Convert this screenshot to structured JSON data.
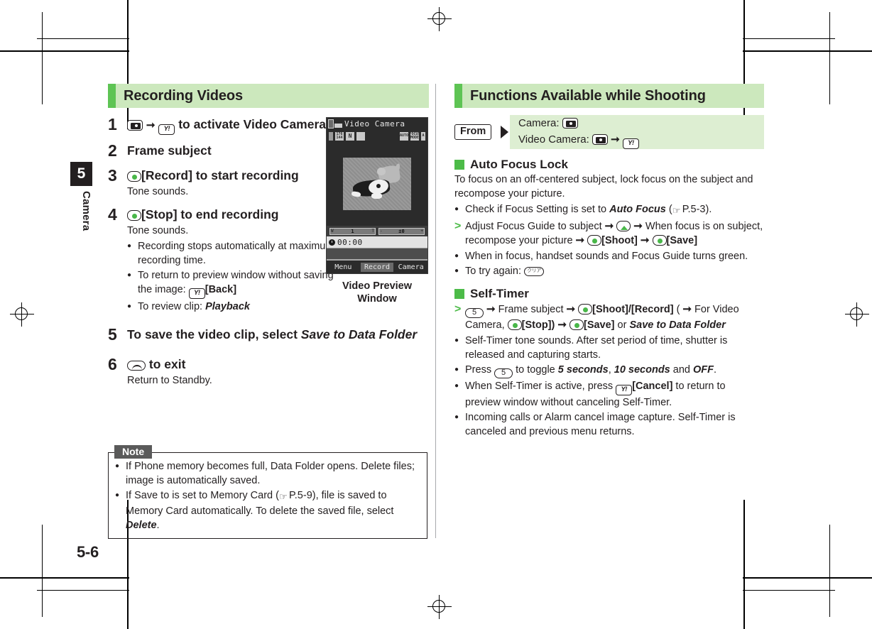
{
  "page": {
    "folio": "5-6",
    "chapter_number": "5",
    "chapter_name": "Camera"
  },
  "left_column": {
    "section_title": "Recording Videos",
    "steps": [
      {
        "number": "1",
        "text_before": "",
        "text_after": " to activate Video Camera",
        "note": ""
      },
      {
        "number": "2",
        "text": "Frame subject"
      },
      {
        "number": "3",
        "label": "[Record] to start recording",
        "note": "Tone sounds."
      },
      {
        "number": "4",
        "label": "[Stop] to end recording",
        "note": "Tone sounds."
      },
      {
        "number": "5",
        "text_plain": "To save the video clip, select ",
        "text_italic": "Save to Data Folder"
      },
      {
        "number": "6",
        "label": " to exit",
        "note": "Return to Standby."
      }
    ],
    "step4_bullets": [
      "Recording stops automatically at maximum recording time.",
      "To return to preview window without saving the image:",
      "To review clip:"
    ],
    "step4_bullet2_key": "[Back]",
    "step4_bullet3_italic": "Playback",
    "note_box": {
      "label": "Note",
      "items": [
        {
          "p1": "If Phone memory becomes full, Data Folder opens. Delete files; image is automatically saved."
        },
        {
          "p1": "If Save to is set to Memory Card (",
          "ref": "P.5-9",
          "p2": "), file is saved to Memory Card automatically. To delete the saved file, select ",
          "em": "Delete",
          "p3": "."
        }
      ]
    },
    "figure": {
      "caption_line1": "Video Preview",
      "caption_line2": "Window",
      "screen": {
        "title": "Video Camera",
        "icons": [
          "176 144",
          "N QVGA",
          "burst",
          "AUTO",
          "FOCUS MODE"
        ],
        "zoom_left": "W",
        "zoom_value": "1",
        "zoom_right": "T",
        "ev_left": "-",
        "ev_value": "±0",
        "ev_right": "+",
        "timer": "00:00",
        "softkeys": [
          "Menu",
          "Record",
          "Camera"
        ]
      }
    }
  },
  "right_column": {
    "section_title": "Functions Available while Shooting",
    "from_banner": {
      "tag": "From",
      "line1_label": "Camera:",
      "line2_label": "Video Camera:"
    },
    "topics": [
      {
        "heading": "Auto Focus Lock",
        "intro": "To focus on an off-centered subject, lock focus on the subject and recompose your picture.",
        "bullets": [
          {
            "p1": "Check if Focus Setting is set to ",
            "em": "Auto Focus",
            "p2": " (",
            "ref": "P.5-3",
            "p3": ")."
          },
          {
            "p1": "When in focus, handset sounds and Focus Guide turns green."
          },
          {
            "p1": "To try again:"
          }
        ],
        "procedure": {
          "p1": "Adjust Focus Guide to subject ",
          "p2": " When focus is on subject, recompose your picture ",
          "shoot": "[Shoot]",
          "save": "[Save]"
        }
      },
      {
        "heading": "Self-Timer",
        "procedure": {
          "p1": "Frame subject ",
          "shoot_record": "[Shoot]/[Record]",
          "p2": "( ",
          "p3": "For Video Camera,",
          "stop": "[Stop])",
          "save": "[Save]",
          "or": " or ",
          "save_to_data_folder": "Save to Data Folder"
        },
        "bullets": [
          {
            "p1": "Self-Timer tone sounds. After set period of time, shutter is released and capturing starts."
          },
          {
            "p1": "Press ",
            "p2": " to toggle ",
            "em1": "5 seconds",
            "sep1": ", ",
            "em2": "10 seconds",
            "sep2": " and ",
            "em3": "OFF",
            "p3": "."
          },
          {
            "p1": "When Self-Timer is active, press ",
            "bold": "[Cancel]",
            "p2": " to return to preview window without canceling Self-Timer."
          },
          {
            "p1": "Incoming calls or Alarm cancel image capture. Self-Timer is canceled and previous menu returns."
          }
        ]
      }
    ]
  },
  "colors": {
    "header_bg": "#cce8bd",
    "header_accent": "#5ec454",
    "banner_bg": "#ddeed2",
    "green_square": "#4cbb48",
    "ink": "#231f20"
  }
}
